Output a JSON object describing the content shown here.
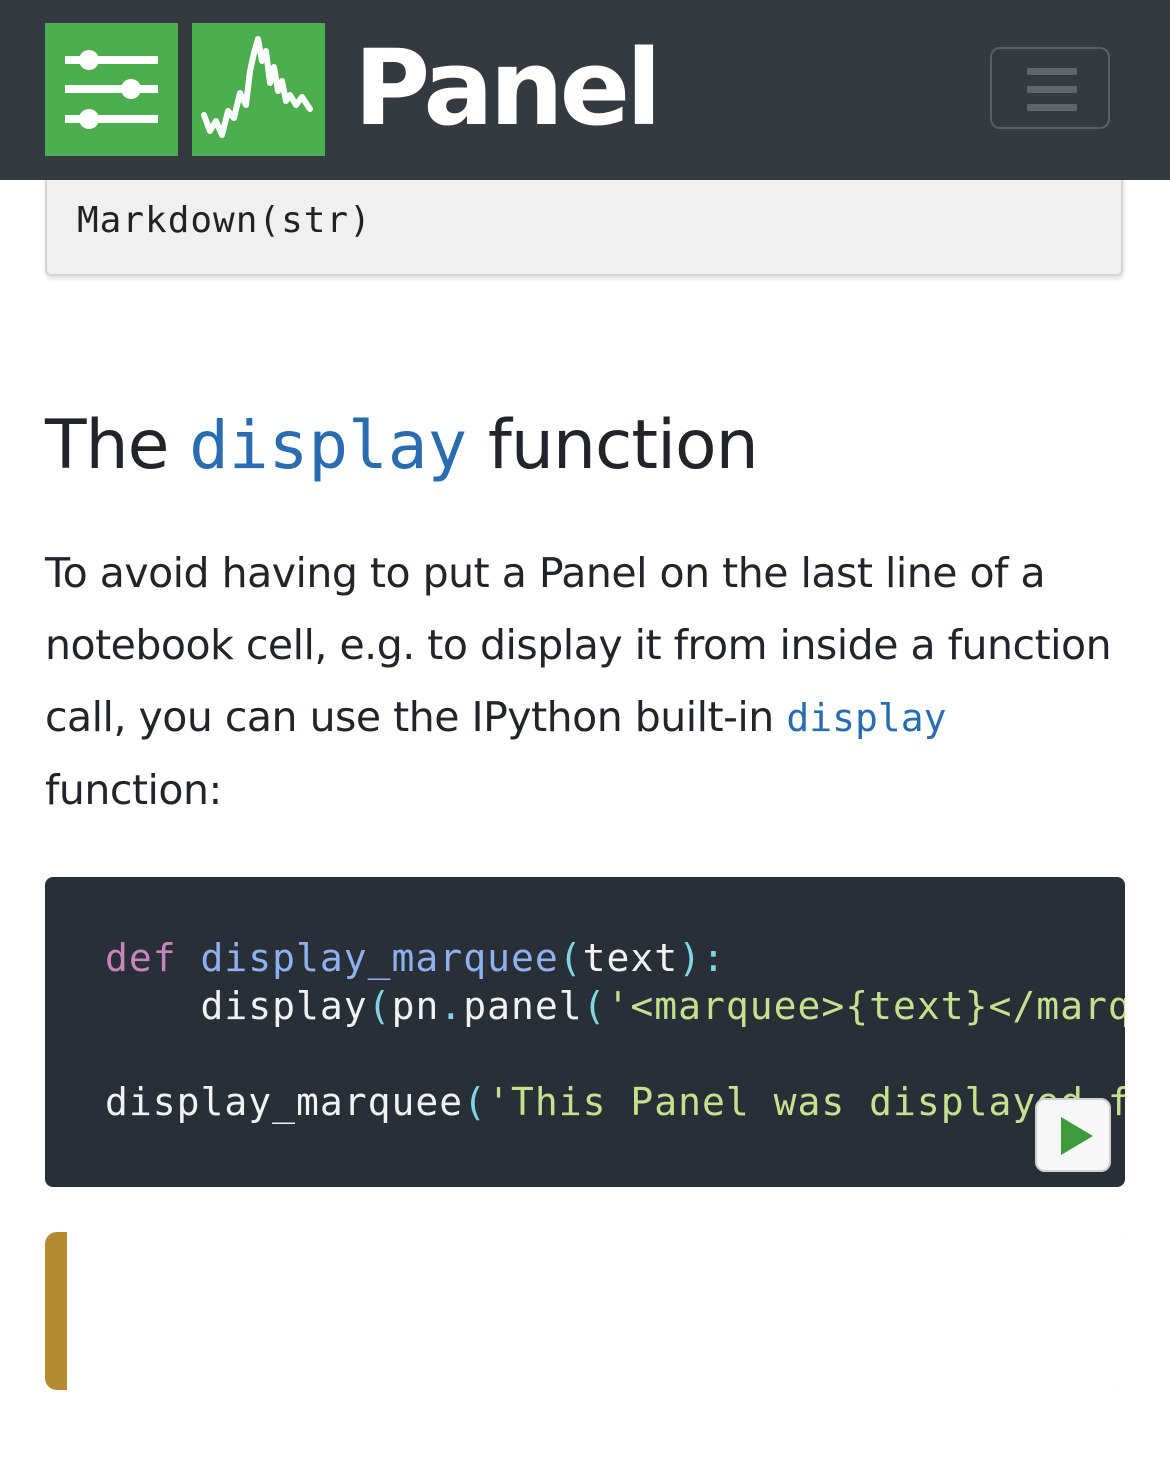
{
  "navbar": {
    "brand": "Panel",
    "logo_icons": [
      "sliders-icon",
      "sparkline-chart-icon"
    ],
    "toggle_icon": "hamburger-menu-icon",
    "colors": {
      "background": "#343a40",
      "logo_green": "#4cae4f"
    }
  },
  "signature": {
    "text": "Markdown(str)"
  },
  "section": {
    "heading_before": "The",
    "heading_code": "display",
    "heading_after": "function",
    "paragraph_text": "To avoid having to put a Panel on the last line of a notebook cell, e.g. to display it from inside a function call, you can use the IPython built-in",
    "paragraph_code": "display",
    "paragraph_tail": "function:"
  },
  "code": {
    "line1_kw": "def",
    "line1_fn": "display_marquee",
    "line1_open": "(",
    "line1_arg": "text",
    "line1_close": "):",
    "line2_fn": "display",
    "line2_open": "(",
    "line2_obj": "pn",
    "line2_dot": ".",
    "line2_method": "panel",
    "line2_open2": "(",
    "line2_str": "'<marquee>{text}</marquee>'",
    "line3_fn": "display_marquee",
    "line3_open": "(",
    "line3_str": "'This Panel was displayed from within a function'",
    "run_icon": "play-icon"
  },
  "output": {
    "accent_color": "#b48b33"
  }
}
